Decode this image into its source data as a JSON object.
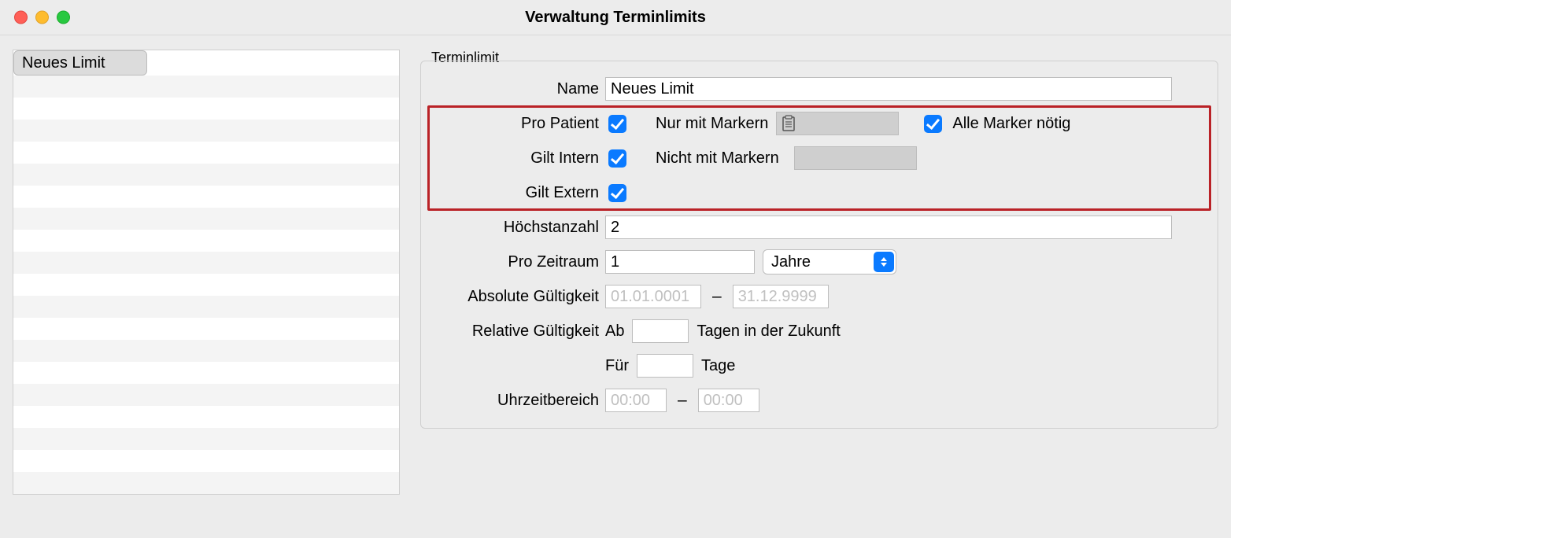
{
  "window": {
    "title": "Verwaltung Terminlimits"
  },
  "sidebar": {
    "selected_index": 0,
    "items": [
      "Neues Limit",
      "",
      "",
      "",
      "",
      "",
      "",
      "",
      "",
      "",
      "",
      "",
      "",
      "",
      "",
      "",
      "",
      "",
      "",
      ""
    ]
  },
  "group": {
    "legend": "Terminlimit"
  },
  "labels": {
    "name": "Name",
    "pro_patient": "Pro Patient",
    "gilt_intern": "Gilt Intern",
    "gilt_extern": "Gilt Extern",
    "nur_mit_markern": "Nur mit Markern",
    "nicht_mit_markern": "Nicht mit Markern",
    "alle_marker": "Alle Marker nötig",
    "hoechstanzahl": "Höchstanzahl",
    "pro_zeitraum": "Pro Zeitraum",
    "absolute_gueltigkeit": "Absolute Gültigkeit",
    "relative_gueltigkeit": "Relative Gültigkeit",
    "uhrzeitbereich": "Uhrzeitbereich",
    "ab": "Ab",
    "tagen_zukunft": "Tagen in der Zukunft",
    "fuer": "Für",
    "tage": "Tage",
    "dash": "–"
  },
  "fields": {
    "name": "Neues Limit",
    "pro_patient": true,
    "gilt_intern": true,
    "gilt_extern": true,
    "alle_marker": true,
    "hoechstanzahl": "2",
    "pro_zeitraum_value": "1",
    "pro_zeitraum_unit": "Jahre",
    "abs_from_placeholder": "01.01.0001",
    "abs_to_placeholder": "31.12.9999",
    "rel_ab": "",
    "rel_fuer": "",
    "time_from_placeholder": "00:00",
    "time_to_placeholder": "00:00"
  }
}
